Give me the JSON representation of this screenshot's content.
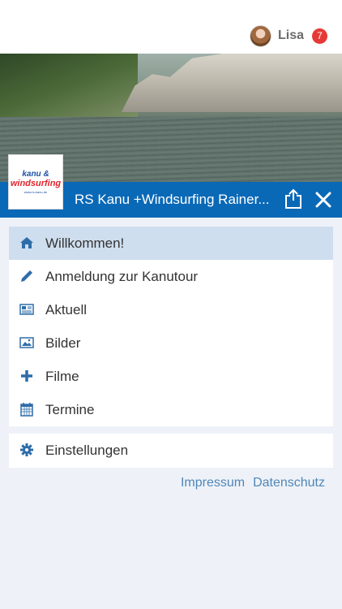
{
  "user": {
    "name": "Lisa",
    "badge_count": "7"
  },
  "header": {
    "title": "RS Kanu +Windsurfing Rainer..."
  },
  "logo": {
    "line1": "kanu &",
    "line2": "windsurfing",
    "line3": "www.rs-kanu.de"
  },
  "menu": {
    "items": [
      {
        "label": "Willkommen!",
        "icon": "home-icon",
        "active": true
      },
      {
        "label": "Anmeldung zur Kanutour",
        "icon": "pencil-icon",
        "active": false
      },
      {
        "label": "Aktuell",
        "icon": "newspaper-icon",
        "active": false
      },
      {
        "label": "Bilder",
        "icon": "image-icon",
        "active": false
      },
      {
        "label": "Filme",
        "icon": "plus-icon",
        "active": false
      },
      {
        "label": "Termine",
        "icon": "calendar-icon",
        "active": false
      }
    ],
    "settings": {
      "label": "Einstellungen",
      "icon": "gear-icon"
    }
  },
  "footer": {
    "impressum": "Impressum",
    "datenschutz": "Datenschutz"
  },
  "colors": {
    "primary": "#0a69b7",
    "icon": "#2e6da8",
    "active_row": "#cfdeee",
    "badge": "#e53935",
    "link": "#4f86b8"
  }
}
